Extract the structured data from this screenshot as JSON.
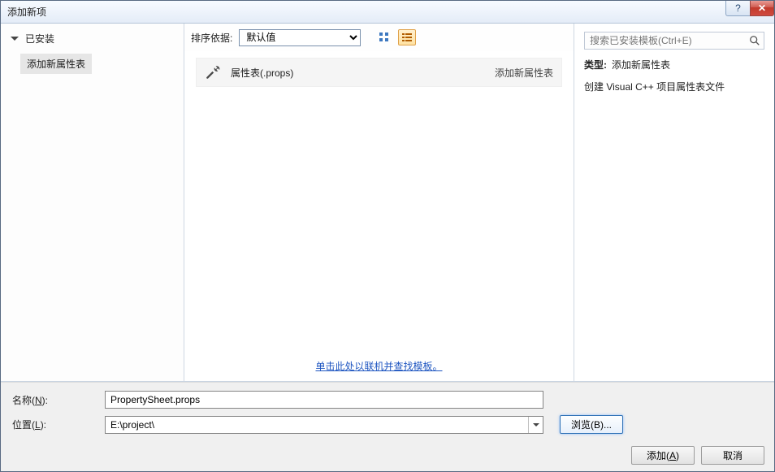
{
  "window": {
    "title": "添加新项"
  },
  "titlebar_buttons": {
    "help": "?",
    "close": "✕"
  },
  "sidebar": {
    "group_label": "已安装",
    "selected_item": "添加新属性表"
  },
  "toolbar": {
    "sort_label": "排序依据:",
    "sort_value": "默认值"
  },
  "search": {
    "placeholder": "搜索已安装模板(Ctrl+E)"
  },
  "template": {
    "name": "属性表(.props)",
    "subtitle": "添加新属性表"
  },
  "info": {
    "type_label": "类型:",
    "type_value": "添加新属性表",
    "description": "创建 Visual C++ 项目属性表文件"
  },
  "online_link": "单击此处以联机并查找模板。",
  "fields": {
    "name_label_prefix": "名称(",
    "name_label_ul": "N",
    "name_label_suffix": "):",
    "name_value": "PropertySheet.props",
    "location_label_prefix": "位置(",
    "location_label_ul": "L",
    "location_label_suffix": "):",
    "location_value": "E:\\project\\",
    "browse_prefix": "浏览(",
    "browse_ul": "B",
    "browse_suffix": ")..."
  },
  "footer": {
    "add_prefix": "添加(",
    "add_ul": "A",
    "add_suffix": ")",
    "cancel": "取消"
  }
}
